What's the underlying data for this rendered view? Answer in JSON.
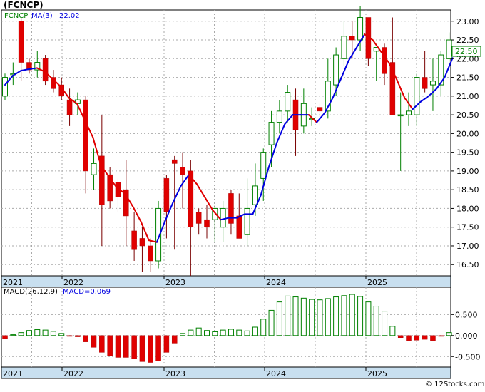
{
  "title": "(FCNCP)",
  "price_label": {
    "ticker": "FCNCP",
    "ma_text": "MA(3)",
    "ma_value": "22.02"
  },
  "macd_label": {
    "name": "MACD(26,12,9)",
    "value_text": "MACD=0.069"
  },
  "last_price": "22.50",
  "watermark": "© 12Stocks.com",
  "colors": {
    "up": "#008000",
    "down": "#e00000",
    "ma_rising": "#0000e0",
    "ma_falling": "#e00000",
    "axis_band": "#c8dfef",
    "grid": "#aaaaaa"
  },
  "chart_data": [
    {
      "type": "candlestick",
      "ylim": [
        16.2,
        23.3
      ],
      "y_ticks": [
        "16.50",
        "17.00",
        "17.50",
        "18.00",
        "18.50",
        "19.00",
        "19.50",
        "20.00",
        "20.50",
        "21.00",
        "21.50",
        "22.00",
        "22.50",
        "23.00"
      ],
      "x_ticks": [
        "2021",
        "2022",
        "2023",
        "2024",
        "2025"
      ],
      "grid": true,
      "legend_placement": "top-left",
      "series": [
        {
          "name": "FCNCP",
          "ohlc": [
            [
              21.0,
              21.6,
              20.9,
              21.5
            ],
            [
              21.6,
              21.9,
              21.3,
              21.6
            ],
            [
              23.0,
              23.1,
              21.4,
              21.9
            ],
            [
              21.9,
              22.0,
              21.6,
              21.7
            ],
            [
              21.7,
              22.2,
              21.5,
              21.9
            ],
            [
              22.0,
              22.1,
              21.3,
              21.4
            ],
            [
              21.5,
              21.7,
              21.1,
              21.2
            ],
            [
              21.3,
              21.5,
              20.9,
              21.0
            ],
            [
              20.9,
              21.2,
              20.2,
              20.5
            ],
            [
              20.8,
              21.1,
              20.5,
              20.9
            ],
            [
              20.9,
              21.0,
              18.4,
              19.0
            ],
            [
              18.9,
              19.6,
              18.5,
              19.2
            ],
            [
              19.4,
              20.5,
              17.0,
              18.1
            ],
            [
              18.9,
              19.1,
              18.0,
              18.2
            ],
            [
              18.7,
              18.8,
              17.9,
              18.3
            ],
            [
              18.5,
              19.3,
              17.0,
              17.8
            ],
            [
              17.4,
              17.9,
              16.6,
              16.9
            ],
            [
              17.2,
              17.5,
              16.3,
              17.0
            ],
            [
              17.0,
              17.2,
              16.3,
              16.6
            ],
            [
              16.6,
              18.2,
              16.4,
              18.0
            ],
            [
              18.8,
              18.9,
              17.2,
              17.9
            ],
            [
              19.3,
              19.4,
              16.9,
              19.2
            ],
            [
              19.1,
              19.5,
              18.0,
              18.9
            ],
            [
              19.0,
              19.3,
              16.2,
              17.5
            ],
            [
              17.9,
              18.0,
              17.3,
              17.6
            ],
            [
              17.7,
              18.1,
              17.2,
              17.5
            ],
            [
              17.7,
              18.1,
              17.1,
              18.0
            ],
            [
              17.5,
              18.2,
              17.1,
              18.0
            ],
            [
              18.4,
              18.5,
              17.3,
              17.6
            ],
            [
              17.8,
              18.4,
              17.2,
              17.2
            ],
            [
              17.3,
              18.8,
              17.0,
              18.0
            ],
            [
              18.1,
              19.2,
              17.8,
              18.6
            ],
            [
              18.8,
              19.6,
              18.2,
              19.5
            ],
            [
              19.7,
              20.6,
              19.1,
              20.3
            ],
            [
              20.3,
              20.9,
              20.0,
              20.6
            ],
            [
              20.6,
              21.3,
              20.3,
              21.1
            ],
            [
              20.9,
              21.2,
              19.4,
              20.1
            ],
            [
              20.2,
              21.2,
              20.0,
              20.8
            ],
            [
              20.4,
              20.7,
              20.2,
              20.4
            ],
            [
              20.7,
              20.8,
              20.2,
              20.6
            ],
            [
              20.6,
              22.0,
              20.4,
              21.4
            ],
            [
              21.3,
              22.3,
              21.0,
              22.1
            ],
            [
              22.0,
              23.0,
              21.8,
              22.6
            ],
            [
              22.6,
              23.0,
              22.0,
              22.5
            ],
            [
              22.5,
              23.4,
              22.2,
              23.1
            ],
            [
              23.1,
              23.1,
              21.8,
              22.0
            ],
            [
              22.2,
              22.3,
              21.4,
              22.3
            ],
            [
              22.3,
              22.4,
              21.3,
              21.6
            ],
            [
              21.9,
              23.1,
              21.3,
              20.5
            ],
            [
              20.5,
              21.1,
              19.0,
              20.5
            ],
            [
              20.5,
              21.1,
              20.2,
              20.6
            ],
            [
              20.5,
              21.6,
              20.2,
              21.5
            ],
            [
              21.5,
              22.2,
              21.1,
              21.2
            ],
            [
              21.3,
              22.0,
              20.6,
              21.4
            ],
            [
              21.3,
              22.2,
              21.0,
              22.1
            ],
            [
              22.0,
              22.7,
              21.8,
              22.5
            ]
          ]
        },
        {
          "name": "MA(3)",
          "values": [
            21.3,
            21.55,
            21.68,
            21.72,
            21.75,
            21.65,
            21.45,
            21.25,
            20.95,
            20.8,
            20.35,
            19.9,
            19.15,
            18.85,
            18.55,
            18.4,
            18.05,
            17.65,
            17.15,
            17.1,
            17.65,
            18.15,
            18.6,
            18.9,
            18.65,
            18.3,
            17.95,
            17.7,
            17.75,
            17.75,
            17.85,
            17.85,
            18.35,
            19.1,
            19.75,
            20.25,
            20.5,
            20.5,
            20.5,
            20.3,
            20.55,
            20.95,
            21.45,
            21.95,
            22.3,
            22.65,
            22.5,
            22.2,
            21.9,
            21.45,
            20.95,
            20.65,
            20.85,
            21.0,
            21.2,
            21.5,
            22.02
          ]
        }
      ]
    },
    {
      "type": "bar",
      "name": "MACD(26,12,9)",
      "ylim": [
        -0.75,
        1.15
      ],
      "y_ticks": [
        "0.500",
        "0.000",
        "-0.500"
      ],
      "x_ticks": [
        "2021",
        "2022",
        "2023",
        "2024",
        "2025"
      ],
      "values": [
        -0.07,
        0.02,
        0.07,
        0.12,
        0.14,
        0.13,
        0.1,
        0.05,
        -0.02,
        -0.03,
        -0.15,
        -0.28,
        -0.4,
        -0.48,
        -0.52,
        -0.52,
        -0.55,
        -0.62,
        -0.64,
        -0.6,
        -0.4,
        -0.18,
        0.05,
        0.13,
        0.18,
        0.12,
        0.09,
        0.13,
        0.15,
        0.13,
        0.11,
        0.2,
        0.39,
        0.6,
        0.8,
        0.94,
        0.92,
        0.89,
        0.86,
        0.85,
        0.88,
        0.92,
        0.95,
        0.98,
        0.93,
        0.8,
        0.7,
        0.58,
        0.22,
        -0.05,
        -0.12,
        -0.11,
        -0.09,
        -0.12,
        -0.02,
        0.07
      ]
    }
  ]
}
